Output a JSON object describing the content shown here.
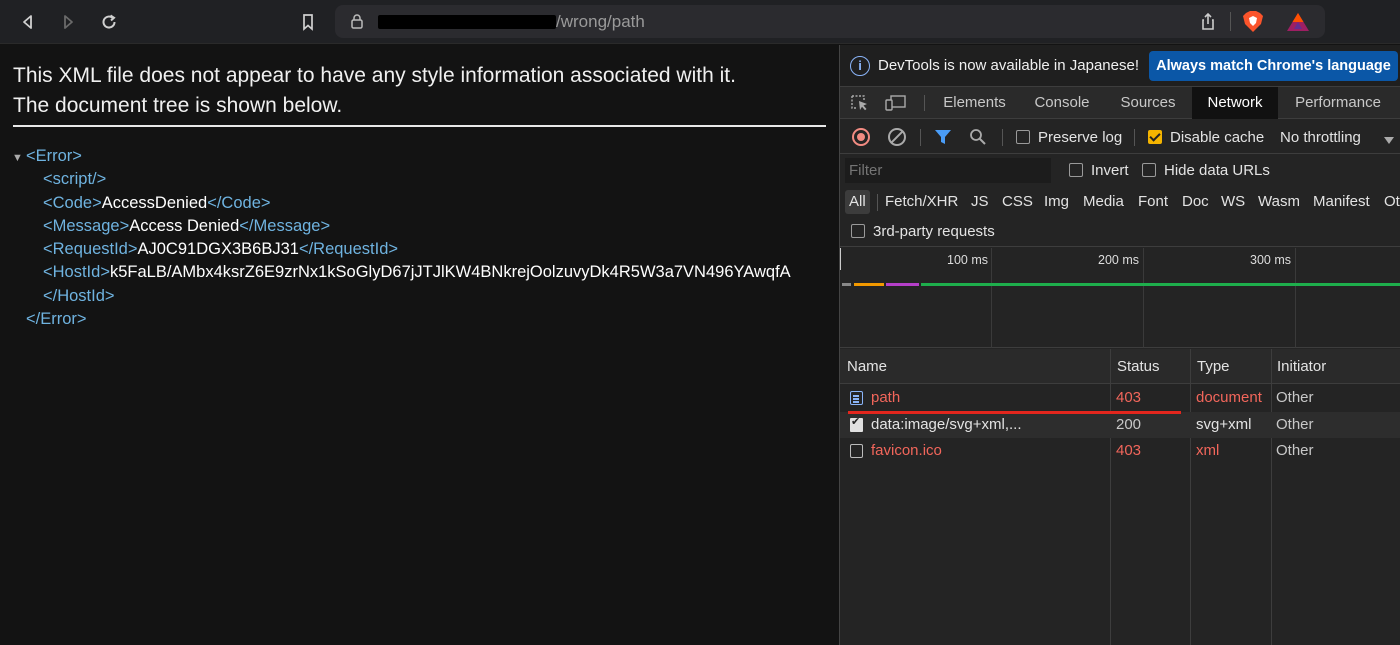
{
  "browser": {
    "url_visible": "/wrong/path"
  },
  "page": {
    "info_line1": "This XML file does not appear to have any style information associated with it.",
    "info_line2": "The document tree is shown below.",
    "xml": {
      "error_open": "<Error>",
      "script": "<script/>",
      "code_open": "<Code>",
      "code_value": "AccessDenied",
      "code_close": "</Code>",
      "message_open": "<Message>",
      "message_value": "Access Denied",
      "message_close": "</Message>",
      "requestid_open": "<RequestId>",
      "requestid_value": "AJ0C91DGX3B6BJ31",
      "requestid_close": "</RequestId>",
      "hostid_open": "<HostId>",
      "hostid_value": "k5FaLB/AMbx4ksrZ6E9zrNx1kSoGlyD67jJTJlKW4BNkrejOolzuvyDk4R5W3a7VN496YAwqfA",
      "hostid_close": "</HostId>",
      "error_close": "</Error>"
    }
  },
  "devtools": {
    "notice": {
      "message": "DevTools is now available in Japanese!",
      "button": "Always match Chrome's language"
    },
    "tabs": [
      "Elements",
      "Console",
      "Sources",
      "Network",
      "Performance"
    ],
    "active_tab": "Network",
    "toolbar": {
      "preserve_log": "Preserve log",
      "disable_cache": "Disable cache",
      "disable_cache_checked": true,
      "throttling": "No throttling"
    },
    "filter": {
      "placeholder": "Filter",
      "invert": "Invert",
      "hide_data_urls": "Hide data URLs"
    },
    "type_filters": [
      "All",
      "Fetch/XHR",
      "JS",
      "CSS",
      "Img",
      "Media",
      "Font",
      "Doc",
      "WS",
      "Wasm",
      "Manifest",
      "Ot"
    ],
    "third_party": "3rd-party requests",
    "timeline": {
      "labels": [
        "100 ms",
        "200 ms",
        "300 ms"
      ]
    },
    "table": {
      "headers": [
        "Name",
        "Status",
        "Type",
        "Initiator"
      ],
      "rows": [
        {
          "name": "path",
          "status": "403",
          "type": "document",
          "initiator": "Other",
          "error": true
        },
        {
          "name": "data:image/svg+xml,...",
          "status": "200",
          "type": "svg+xml",
          "initiator": "Other",
          "error": false
        },
        {
          "name": "favicon.ico",
          "status": "403",
          "type": "xml",
          "initiator": "Other",
          "error": true
        }
      ]
    },
    "colors": {
      "error": "#f2665b",
      "tag": "#6fb3e0",
      "accent_button": "#0b57a7"
    }
  }
}
